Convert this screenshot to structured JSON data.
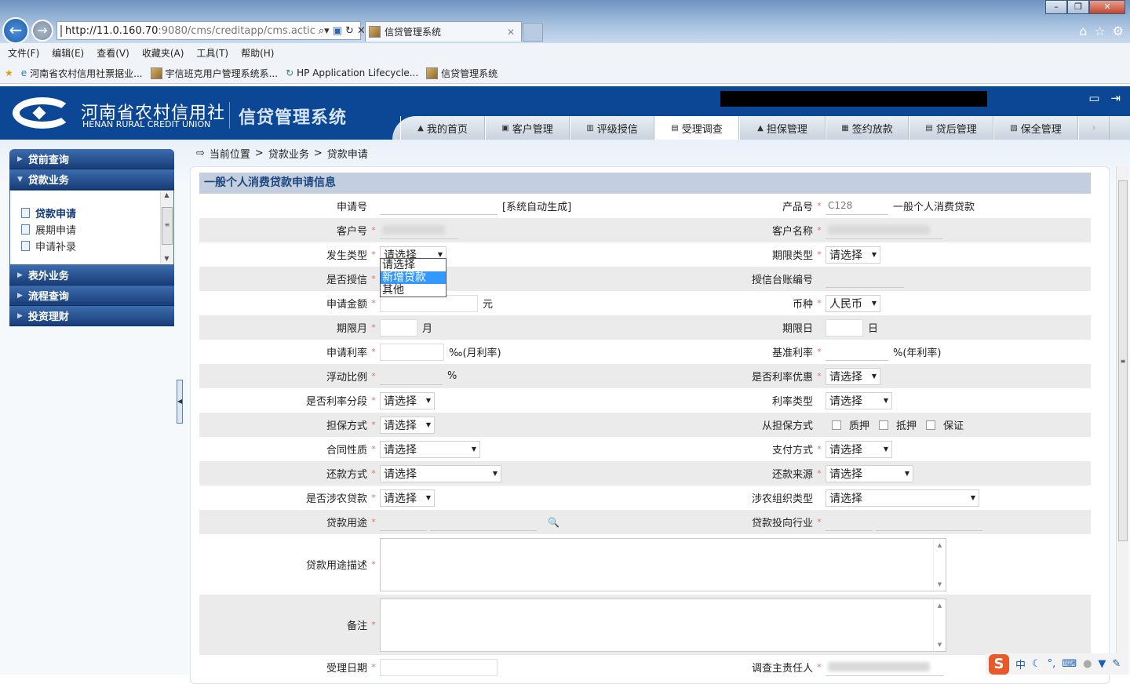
{
  "browser": {
    "url_host": "http://11.0.160.70",
    "url_path": ":9080/cms/creditapp/cms.actic",
    "tab_title": "信贷管理系统",
    "menu": [
      "文件(F)",
      "编辑(E)",
      "查看(V)",
      "收藏夹(A)",
      "工具(T)",
      "帮助(H)"
    ],
    "favorites": [
      "河南省农村信用社票据业...",
      "宇信班克用户管理系统系...",
      "HP Application Lifecycle...",
      "信贷管理系统"
    ]
  },
  "header": {
    "org_cn": "河南省农村信用社",
    "org_en": "HENAN RURAL CREDIT UNION",
    "system_title": "信贷管理系统",
    "nav_tabs": [
      {
        "label": "我的首页",
        "icon": "home-icon"
      },
      {
        "label": "客户管理",
        "icon": "user-card-icon"
      },
      {
        "label": "评级授信",
        "icon": "trash-icon"
      },
      {
        "label": "受理调查",
        "icon": "phone-icon",
        "active": true
      },
      {
        "label": "担保管理",
        "icon": "warning-icon"
      },
      {
        "label": "签约放款",
        "icon": "building-icon"
      },
      {
        "label": "贷后管理",
        "icon": "database-icon"
      },
      {
        "label": "保全管理",
        "icon": "copy-icon"
      }
    ]
  },
  "sidebar": {
    "sections": [
      "贷前查询",
      "贷款业务",
      "表外业务",
      "流程查询",
      "投资理财"
    ],
    "items": [
      "贷款申请",
      "展期申请",
      "申请补录"
    ],
    "active_item": "贷款申请"
  },
  "breadcrumb": [
    "当前位置",
    "贷款业务",
    "贷款申请"
  ],
  "form": {
    "title": "一般个人消费贷款申请信息",
    "required_mark": "*",
    "rows": [
      {
        "left": {
          "label": "申请号",
          "type": "text",
          "value": "",
          "suffix": "[系统自动生成]"
        },
        "right": {
          "label": "产品号",
          "req": true,
          "type": "text",
          "value": "C128",
          "suffix": "一般个人消费贷款"
        }
      },
      {
        "left": {
          "label": "客户号",
          "req": true,
          "type": "blur"
        },
        "right": {
          "label": "客户名称",
          "req": true,
          "type": "blur"
        }
      },
      {
        "left": {
          "label": "发生类型",
          "req": true,
          "type": "select",
          "value": "请选择"
        },
        "right": {
          "label": "期限类型",
          "req": true,
          "type": "select",
          "value": "请选择"
        }
      },
      {
        "left": {
          "label": "是否授信",
          "req": true,
          "type": "none"
        },
        "right": {
          "label": "授信台账编号",
          "type": "text",
          "value": ""
        }
      },
      {
        "left": {
          "label": "申请金额",
          "req": true,
          "type": "text",
          "value": "",
          "suffix": "元"
        },
        "right": {
          "label": "币种",
          "req": true,
          "type": "select",
          "value": "人民币"
        }
      },
      {
        "left": {
          "label": "期限月",
          "req": true,
          "type": "text",
          "value": "",
          "suffix": "月"
        },
        "right": {
          "label": "期限日",
          "type": "text",
          "value": "",
          "suffix": "日"
        }
      },
      {
        "left": {
          "label": "申请利率",
          "req": true,
          "type": "text",
          "value": "",
          "suffix": "‰(月利率)"
        },
        "right": {
          "label": "基准利率",
          "req": true,
          "type": "text",
          "value": "",
          "suffix": "%(年利率)"
        }
      },
      {
        "left": {
          "label": "浮动比例",
          "req": true,
          "type": "text",
          "value": "",
          "suffix": "%"
        },
        "right": {
          "label": "是否利率优惠",
          "req": true,
          "type": "select",
          "value": "请选择"
        }
      },
      {
        "left": {
          "label": "是否利率分段",
          "req": true,
          "type": "select",
          "value": "请选择"
        },
        "right": {
          "label": "利率类型",
          "type": "select",
          "value": "请选择"
        }
      },
      {
        "left": {
          "label": "担保方式",
          "req": true,
          "type": "select",
          "value": "请选择"
        },
        "right": {
          "label": "从担保方式",
          "type": "checks",
          "options": [
            "质押",
            "抵押",
            "保证"
          ]
        }
      },
      {
        "left": {
          "label": "合同性质",
          "req": true,
          "type": "select",
          "value": "请选择"
        },
        "right": {
          "label": "支付方式",
          "req": true,
          "type": "select",
          "value": "请选择"
        }
      },
      {
        "left": {
          "label": "还款方式",
          "req": true,
          "type": "select",
          "value": "请选择"
        },
        "right": {
          "label": "还款来源",
          "req": true,
          "type": "select",
          "value": "请选择"
        }
      },
      {
        "left": {
          "label": "是否涉农贷款",
          "req": true,
          "type": "select",
          "value": "请选择"
        },
        "right": {
          "label": "涉农组织类型",
          "type": "select",
          "value": "请选择"
        }
      },
      {
        "left": {
          "label": "贷款用途",
          "req": true,
          "type": "lookup"
        },
        "right": {
          "label": "贷款投向行业",
          "req": true,
          "type": "pair"
        }
      },
      {
        "full": {
          "label": "贷款用途描述",
          "req": true,
          "type": "textarea",
          "value": ""
        }
      },
      {
        "full": {
          "label": "备注",
          "req": true,
          "type": "textarea",
          "value": ""
        }
      },
      {
        "left": {
          "label": "受理日期",
          "req": true,
          "type": "date",
          "value": ""
        },
        "right": {
          "label": "调查主责任人",
          "req": true,
          "type": "blur"
        }
      }
    ],
    "open_dropdown": {
      "options": [
        "请选择",
        "新增贷款",
        "其他"
      ],
      "highlighted": "新增贷款"
    }
  },
  "ime": {
    "logo": "S",
    "mode": "中"
  },
  "colors": {
    "header_blue": "#0c4795",
    "section_title_bg": "#c3cfdf",
    "required": "#e07070",
    "highlight": "#3399ff"
  }
}
